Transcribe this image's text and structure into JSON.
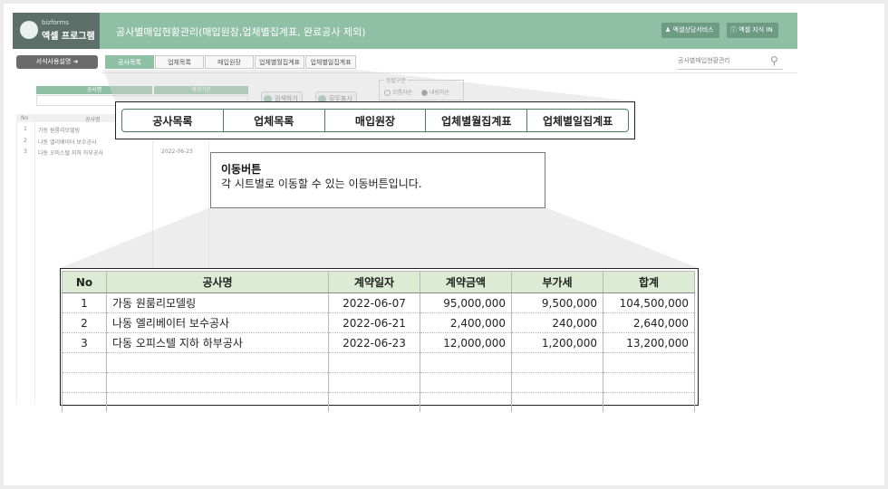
{
  "app": {
    "logo_sub": "bizforms",
    "logo_main": "엑셀 프로그램",
    "title": "공사별매입현황관리(매입원장,업체별집계표, 완료공사 제외)",
    "header_buttons": [
      "엑셀상담서비스",
      "엑셀 지식 IN"
    ]
  },
  "toolbar": {
    "guide_label": "서식사용설명",
    "nav_tabs": [
      "공사목록",
      "업체목록",
      "매입원장",
      "업체별월집계표",
      "업체별일집계표"
    ],
    "search_placeholder": "공사별매입현황관리"
  },
  "background_sheet": {
    "filter_headers": [
      "공사명",
      "계약기간"
    ],
    "buttons": [
      "검색하기",
      "모두표시"
    ],
    "sort_legend": "정렬구분",
    "sort_options": [
      "오름차순",
      "내림차순"
    ],
    "selected_sort": "내림차순",
    "col_headers": [
      "No",
      "공사명"
    ],
    "rows": [
      {
        "no": "1",
        "name": "가동 원룸리모델링",
        "date": "",
        "amt1": "",
        "amt2": "",
        "amt3": ""
      },
      {
        "no": "2",
        "name": "나동 엘리베이터 보수공사",
        "date": "",
        "amt1": "",
        "amt2": "",
        "amt3": ""
      },
      {
        "no": "3",
        "name": "다동 오피스텔 지하 하부공사",
        "date": "2022-06-23",
        "amt1": "",
        "amt2": "",
        "amt3": ""
      }
    ]
  },
  "callout_tabs": [
    "공사목록",
    "업체목록",
    "매입원장",
    "업체별월집계표",
    "업체별일집계표"
  ],
  "description": {
    "title": "이동버튼",
    "text": "각 시트별로 이동할 수 있는 이동버튼입니다."
  },
  "table": {
    "headers": [
      "No",
      "공사명",
      "계약일자",
      "계약금액",
      "부가세",
      "합계"
    ],
    "rows": [
      {
        "no": "1",
        "name": "가동 원룸리모델링",
        "date": "2022-06-07",
        "amount": "95,000,000",
        "vat": "9,500,000",
        "total": "104,500,000"
      },
      {
        "no": "2",
        "name": "나동 엘리베이터 보수공사",
        "date": "2022-06-21",
        "amount": "2,400,000",
        "vat": "240,000",
        "total": "2,640,000"
      },
      {
        "no": "3",
        "name": "다동 오피스텔 지하 하부공사",
        "date": "2022-06-23",
        "amount": "12,000,000",
        "vat": "1,200,000",
        "total": "13,200,000"
      }
    ]
  },
  "colors": {
    "header_green": "#8fbfa5",
    "logo_bg": "#5d6f69",
    "table_header": "#dcebd3",
    "tab_border": "#4e7d66"
  }
}
